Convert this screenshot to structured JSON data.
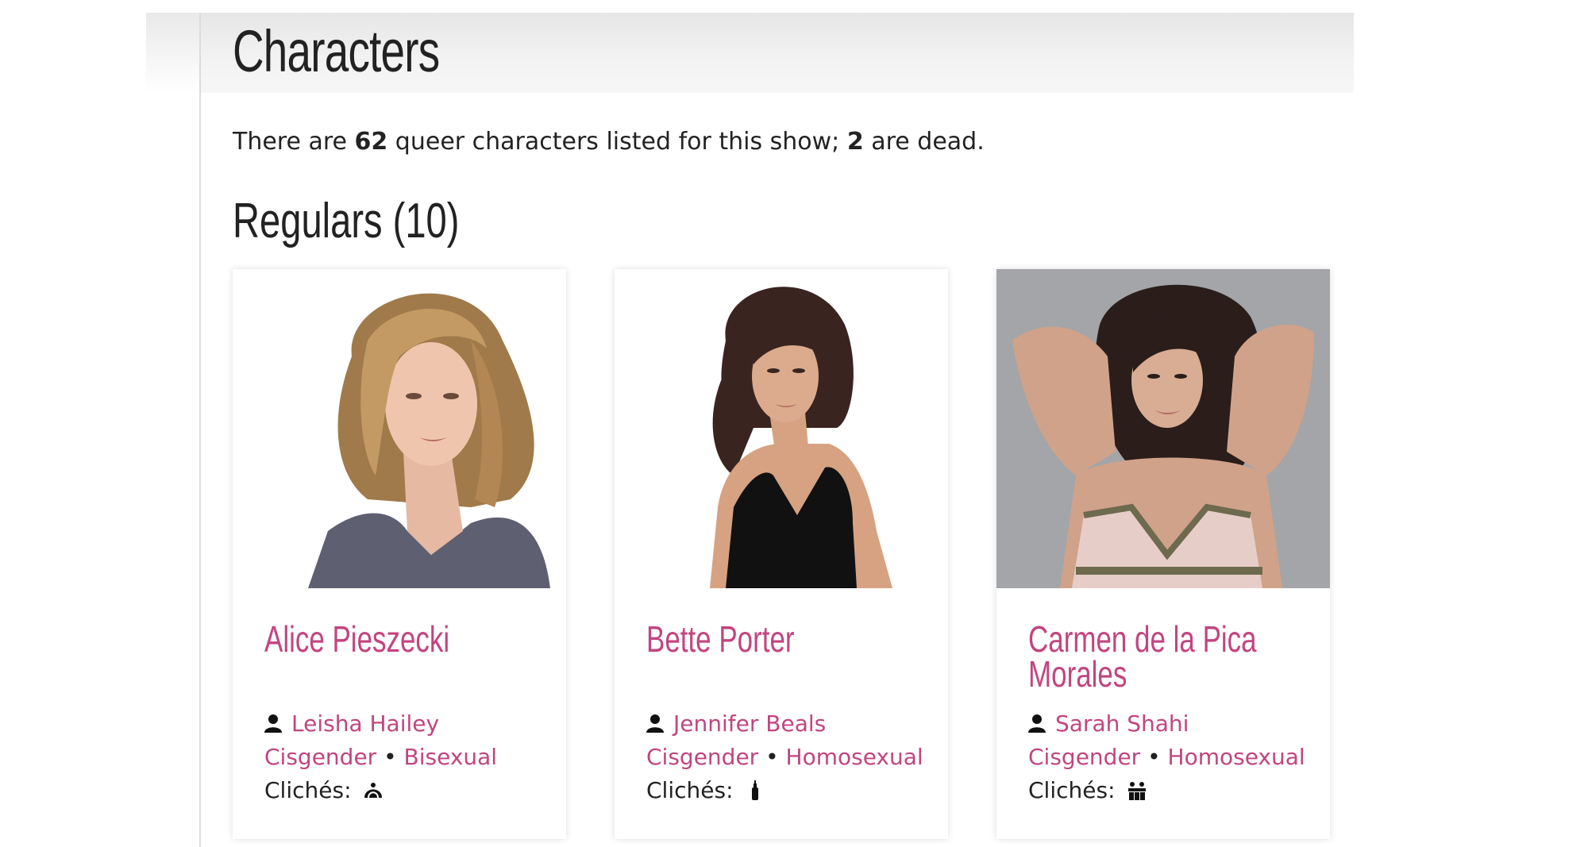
{
  "page": {
    "title": "Characters",
    "summary_before": "There are ",
    "summary_count": "62",
    "summary_middle": " queer characters listed for this show; ",
    "summary_dead": "2",
    "summary_after": " are dead.",
    "section_title": "Regulars (10)"
  },
  "colors": {
    "link": "#c2457f",
    "text": "#222222"
  },
  "characters": [
    {
      "name": "Alice Pieszecki",
      "actor": "Leisha Hailey",
      "gender": "Cisgender",
      "separator": "•",
      "sexuality": "Bisexual",
      "cliches_label": "Clichés:",
      "cliche_icon": "cliche-icon"
    },
    {
      "name": "Bette Porter",
      "actor": "Jennifer Beals",
      "gender": "Cisgender",
      "separator": "•",
      "sexuality": "Homosexual",
      "cliches_label": "Clichés:",
      "cliche_icon": "cliche-icon"
    },
    {
      "name": "Carmen de la Pica Morales",
      "actor": "Sarah Shahi",
      "gender": "Cisgender",
      "separator": "•",
      "sexuality": "Homosexual",
      "cliches_label": "Clichés:",
      "cliche_icon": "cliche-icon"
    }
  ]
}
